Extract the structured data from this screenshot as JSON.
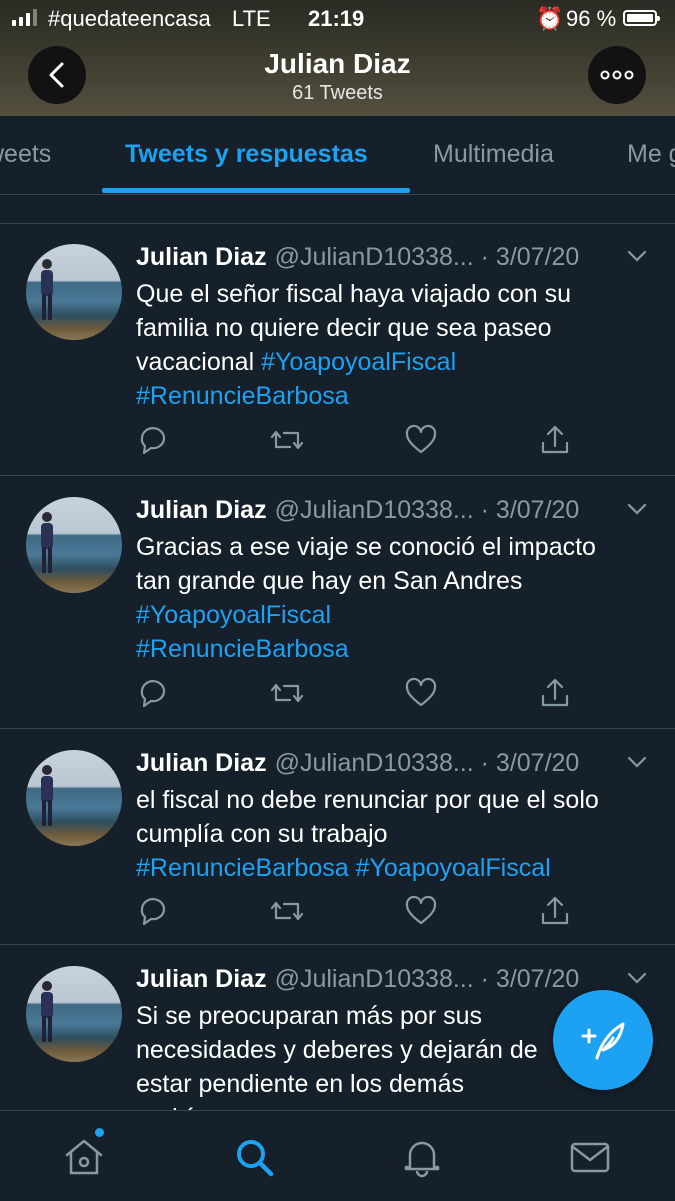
{
  "status_bar": {
    "carrier": "#quedateencasa",
    "network": "LTE",
    "time": "21:19",
    "battery": "96 %"
  },
  "header": {
    "title": "Julian Diaz",
    "subtitle": "61 Tweets"
  },
  "tabs": [
    {
      "label": "weets"
    },
    {
      "label": "Tweets y respuestas"
    },
    {
      "label": "Multimedia"
    },
    {
      "label": "Me g"
    }
  ],
  "tweets": [
    {
      "name": "Julian Diaz",
      "meta": "@JulianD10338... · 3/07/20",
      "text": "Que el señor fiscal haya viajado con su familia no quiere decir que sea paseo vacacional ",
      "tags": [
        "#YoapoyoalFiscal",
        "#RenuncieBarbosa"
      ]
    },
    {
      "name": "Julian Diaz",
      "meta": "@JulianD10338... · 3/07/20",
      "text": "Gracias a ese viaje se conoció el impacto tan grande que hay en San Andres",
      "tags": [
        "#YoapoyoalFiscal",
        "#RenuncieBarbosa"
      ]
    },
    {
      "name": "Julian Diaz",
      "meta": "@JulianD10338... · 3/07/20",
      "text": "el fiscal no debe renunciar por que el solo cumplía con su trabajo",
      "tags": [
        "#RenuncieBarbosa",
        "#YoapoyoalFiscal"
      ]
    },
    {
      "name": "Julian Diaz",
      "meta": "@JulianD10338... · 3/07/20",
      "text": "Si se preocuparan más por sus necesidades y deberes y dejarán de estar pendiente en los demás podrían",
      "tags": []
    }
  ],
  "colors": {
    "background": "#15202b",
    "accent": "#1da1f2",
    "muted": "#8899a6",
    "divider": "#38444d"
  },
  "icons": {
    "reply": "reply-icon",
    "retweet": "retweet-icon",
    "like": "like-icon",
    "share": "share-icon",
    "compose": "compose-tweet-icon",
    "nav": [
      "home-icon",
      "search-icon",
      "notifications-icon",
      "messages-icon"
    ]
  }
}
